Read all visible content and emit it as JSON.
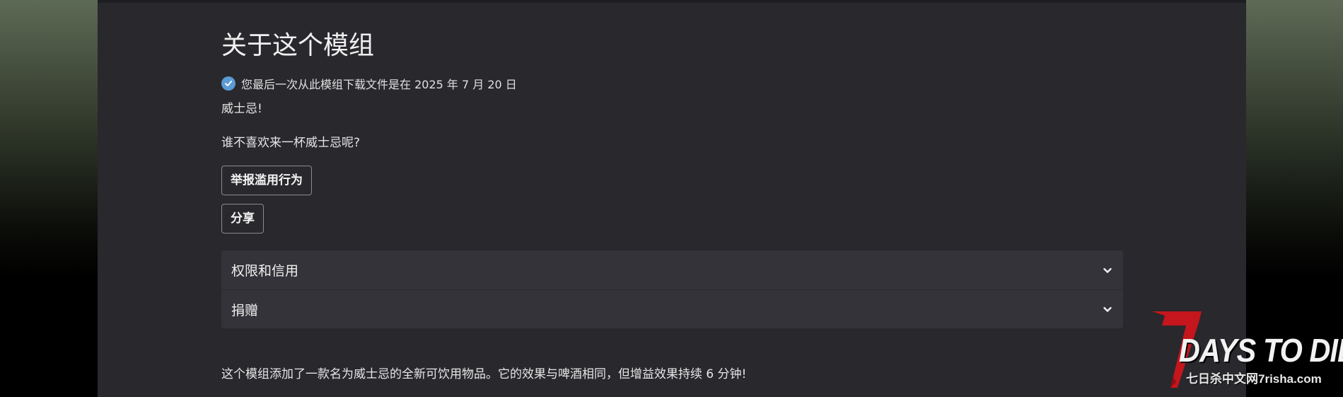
{
  "main": {
    "title": "关于这个模组",
    "download_note": "您最后一次从此模组下载文件是在 2025 年 7 月 20 日",
    "paragraphs": [
      "威士忌!",
      "谁不喜欢来一杯威士忌呢?"
    ],
    "report_button": "举报滥用行为",
    "share_button": "分享",
    "accordion": [
      {
        "label": "权限和信用"
      },
      {
        "label": "捐赠"
      }
    ],
    "description": "这个模组添加了一款名为威士忌的全新可饮用物品。它的效果与啤酒相同，但增益效果持续 6 分钟!"
  },
  "watermark": {
    "logo_text": "DAYS TO DIE",
    "subtext": "七日杀中文网7risha.com"
  },
  "colors": {
    "panel_bg": "#29282d",
    "accordion_bg": "#343339",
    "check_badge": "#5b9bd5",
    "logo_red": "#c4161c"
  },
  "icons": [
    "check-circle-icon",
    "chevron-down-icon"
  ]
}
